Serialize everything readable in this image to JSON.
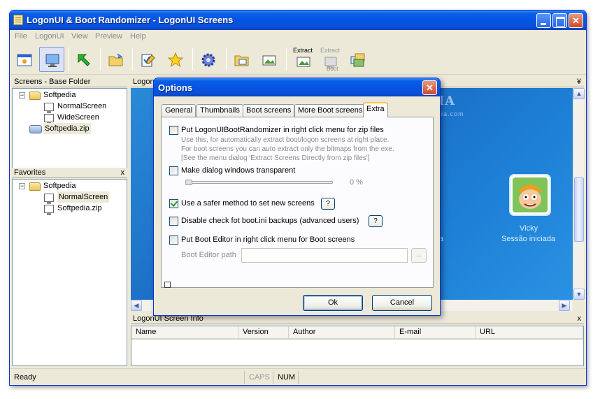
{
  "window": {
    "title": "LogonUI & Boot Randomizer - LogonUI Screens",
    "controls": {
      "minimize": "_",
      "maximize": "□",
      "close": "✕"
    }
  },
  "menu": [
    "File",
    "LogonUI",
    "View",
    "Preview",
    "Help"
  ],
  "toolbar": {
    "extract_label": "Extract",
    "extract_boot_label": "Extract",
    "extract_boot_sub": "Boot"
  },
  "screens_pane": {
    "title": "Screens - Base Folder",
    "tree": {
      "root": "Softpedia",
      "children": [
        "NormalScreen",
        "WideScreen"
      ],
      "zip": "Softpedia.zip"
    },
    "collapse": "−"
  },
  "favorites_pane": {
    "title": "Favorites",
    "close": "x",
    "tree": {
      "root": "Softpedia",
      "children": [
        "NormalScreen",
        "Softpedia.zip"
      ]
    },
    "collapse": "−"
  },
  "preview": {
    "title": "LogonU",
    "pin": "¥",
    "username": "Vicky",
    "status": "Sessão iniciada",
    "left_status_fragment": "a",
    "scroll_up": "▲",
    "scroll_down": "▼",
    "scroll_left": "◀",
    "scroll_right": "▶"
  },
  "info_pane": {
    "title": "LogonUI Screen Info",
    "close": "x",
    "columns": [
      "Name",
      "Version",
      "Author",
      "E-mail",
      "URL"
    ]
  },
  "statusbar": {
    "status": "Ready",
    "caps": "CAPS",
    "num": "NUM"
  },
  "dialog": {
    "title": "Options",
    "close": "✕",
    "tabs": [
      "General",
      "Thumbnails",
      "Boot screens",
      "More Boot screens",
      "Extra"
    ],
    "active_tab": "Extra",
    "options": {
      "zip_menu": {
        "label": "Put LogonUIBootRandomizer in right click menu for zip files",
        "checked": false,
        "help": [
          "Use this, for automatically extract boot/logon screens at right place.",
          "For boot screens you can auto extract only the bitmaps from the exe.",
          "[See the menu dialog 'Extract Screens Directly from zip files']"
        ]
      },
      "transparent": {
        "label": "Make dialog windows transparent",
        "checked": false,
        "value_text": "0 %",
        "value": 0
      },
      "safer": {
        "label": "Use a safer method to set new screens",
        "checked": true,
        "help_button": "?"
      },
      "bootini": {
        "label": "Disable check fot boot.ini backups (advanced users)",
        "checked": false,
        "help_button": "?"
      },
      "boot_editor": {
        "label": "Put Boot Editor in right click menu for Boot screens",
        "checked": false,
        "path_label": "Boot Editor path",
        "path_value": "",
        "browse": "..."
      }
    },
    "ok": "Ok",
    "cancel": "Cancel"
  },
  "watermarks": {
    "main": "SOFTPEDIA",
    "sub": "www.softpedia.com"
  }
}
